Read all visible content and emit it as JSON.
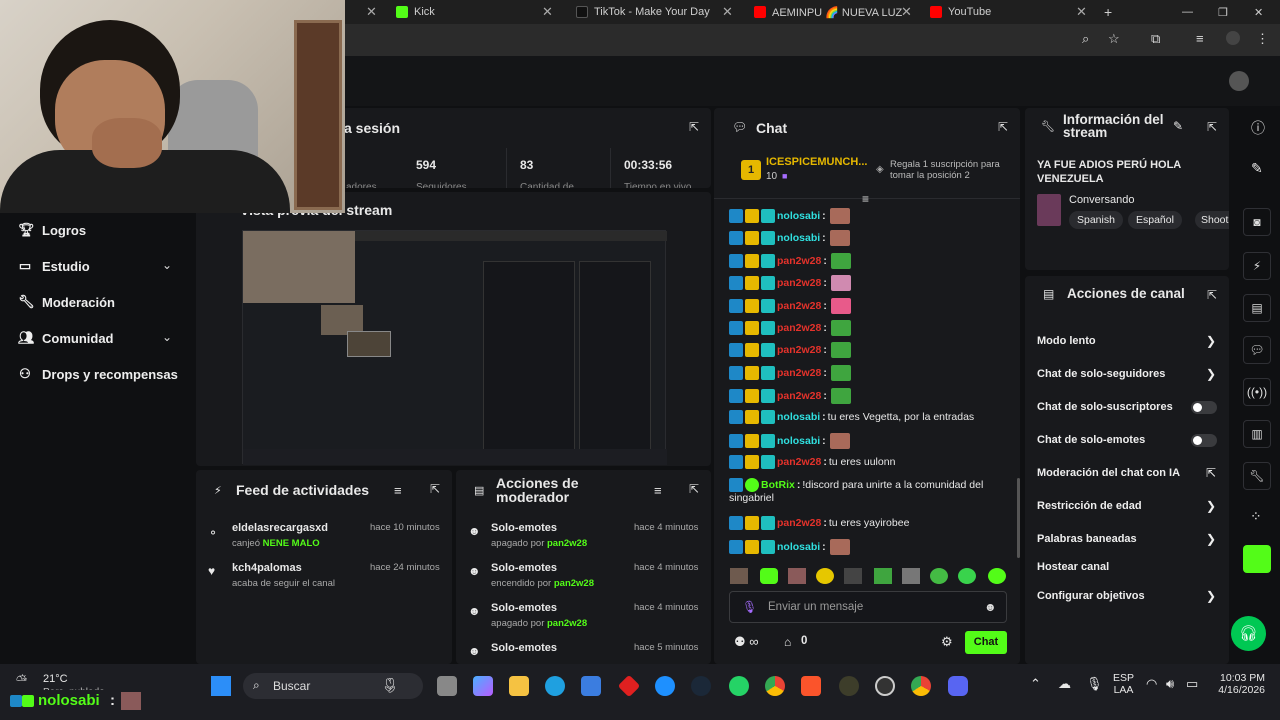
{
  "browser": {
    "tabs": [
      {
        "label": "Kick",
        "color": "#53fc18"
      },
      {
        "label": "TikTok - Make Your Day",
        "color": "#111"
      },
      {
        "label": "AEMINPU 🌈 NUEVA LUZ",
        "color": "#ff0000"
      },
      {
        "label": "YouTube",
        "color": "#ff0000"
      }
    ],
    "new_tab": "+"
  },
  "session": {
    "title": "a sesión",
    "stats": [
      {
        "value": "594",
        "label": "Seguidores"
      },
      {
        "value": "83",
        "label": "Cantidad de"
      },
      {
        "value": "00:33:56",
        "label": "Tiempo en vivo"
      }
    ],
    "left_partial_label": "adores"
  },
  "preview": {
    "title": "Vista previa del stream"
  },
  "sidebar": {
    "items": [
      {
        "label": "Logros",
        "icon": "trophy-icon"
      },
      {
        "label": "Estudio",
        "icon": "film-icon"
      },
      {
        "label": "Moderación",
        "icon": "wrench-icon"
      },
      {
        "label": "Comunidad",
        "icon": "people-icon"
      },
      {
        "label": "Drops y recompensas",
        "icon": "drops-icon"
      }
    ]
  },
  "chat": {
    "title": "Chat",
    "pinned": {
      "rank": "1",
      "name": "ICESPICEMUNCH...",
      "count": "10",
      "gift_text": "Regala 1 suscripción para tomar la posición 2"
    },
    "messages": [
      {
        "user": "nolosabi",
        "color": "cyan",
        "text": ""
      },
      {
        "user": "nolosabi",
        "color": "cyan",
        "text": ""
      },
      {
        "user": "pan2w28",
        "color": "red",
        "text": ""
      },
      {
        "user": "pan2w28",
        "color": "red",
        "text": ""
      },
      {
        "user": "pan2w28",
        "color": "red",
        "text": ""
      },
      {
        "user": "pan2w28",
        "color": "red",
        "text": ""
      },
      {
        "user": "pan2w28",
        "color": "red",
        "text": ""
      },
      {
        "user": "pan2w28",
        "color": "red",
        "text": ""
      },
      {
        "user": "pan2w28",
        "color": "red",
        "text": ""
      },
      {
        "user": "nolosabi",
        "color": "cyan",
        "text": "tu eres Vegetta, por la entradas"
      },
      {
        "user": "nolosabi",
        "color": "cyan",
        "text": ""
      },
      {
        "user": "pan2w28",
        "color": "red",
        "text": "tu eres uulonn"
      },
      {
        "user": "BotRix",
        "color": "green",
        "text": "!discord para unirte a la comunidad del"
      },
      {
        "user": "",
        "color": "none",
        "text": "singabriel"
      },
      {
        "user": "pan2w28",
        "color": "red",
        "text": "tu eres yayirobee"
      },
      {
        "user": "nolosabi",
        "color": "cyan",
        "text": ""
      }
    ],
    "input_placeholder": "Enviar un mensaje",
    "points": "0",
    "send_label": "Chat"
  },
  "stream_info": {
    "title": "Información del stream",
    "stream_title": "YA FUE ADIOS PERÚ HOLA VENEZUELA",
    "category": "Conversando",
    "tags": [
      "Spanish",
      "Español",
      "Shoot"
    ]
  },
  "channel_actions": {
    "title": "Acciones de canal",
    "items": [
      {
        "label": "Modo lento",
        "control": "chevron"
      },
      {
        "label": "Chat de solo-seguidores",
        "control": "chevron"
      },
      {
        "label": "Chat de solo-suscriptores",
        "control": "toggle"
      },
      {
        "label": "Chat de solo-emotes",
        "control": "toggle"
      },
      {
        "label": "Moderación del chat con IA",
        "control": "external"
      },
      {
        "label": "Restricción de edad",
        "control": "chevron"
      },
      {
        "label": "Palabras baneadas",
        "control": "chevron"
      },
      {
        "label": "Hostear canal",
        "control": "none"
      },
      {
        "label": "Configurar objetivos",
        "control": "chevron"
      }
    ]
  },
  "activity_feed": {
    "title": "Feed de actividades",
    "items": [
      {
        "user": "eldelasrecargasxd",
        "time": "hace 10 minutos",
        "action": "canjeó",
        "highlight": "NENE MALO"
      },
      {
        "user": "kch4palomas",
        "time": "hace 24 minutos",
        "action": "acaba de seguir el canal",
        "highlight": ""
      }
    ]
  },
  "mod_actions": {
    "title": "Acciones de moderador",
    "items": [
      {
        "title": "Solo-emotes",
        "time": "hace 4 minutos",
        "status": "apagado por",
        "by": "pan2w28"
      },
      {
        "title": "Solo-emotes",
        "time": "hace 4 minutos",
        "status": "encendido por",
        "by": "pan2w28"
      },
      {
        "title": "Solo-emotes",
        "time": "hace 4 minutos",
        "status": "apagado por",
        "by": "pan2w28"
      },
      {
        "title": "Solo-emotes",
        "time": "hace 5 minutos",
        "status": "",
        "by": ""
      }
    ]
  },
  "overlay": {
    "user": "nolosabi",
    "sep": ":"
  },
  "taskbar": {
    "weather_temp": "21°C",
    "weather_desc": "Parc. nublado",
    "search_placeholder": "Buscar",
    "lang": "ESP",
    "lang2": "LAA",
    "time": "10:03 PM",
    "date": "4/16/2026"
  },
  "colors": {
    "accent": "#53fc18",
    "panel": "#18191c",
    "bg": "#0f1012"
  }
}
